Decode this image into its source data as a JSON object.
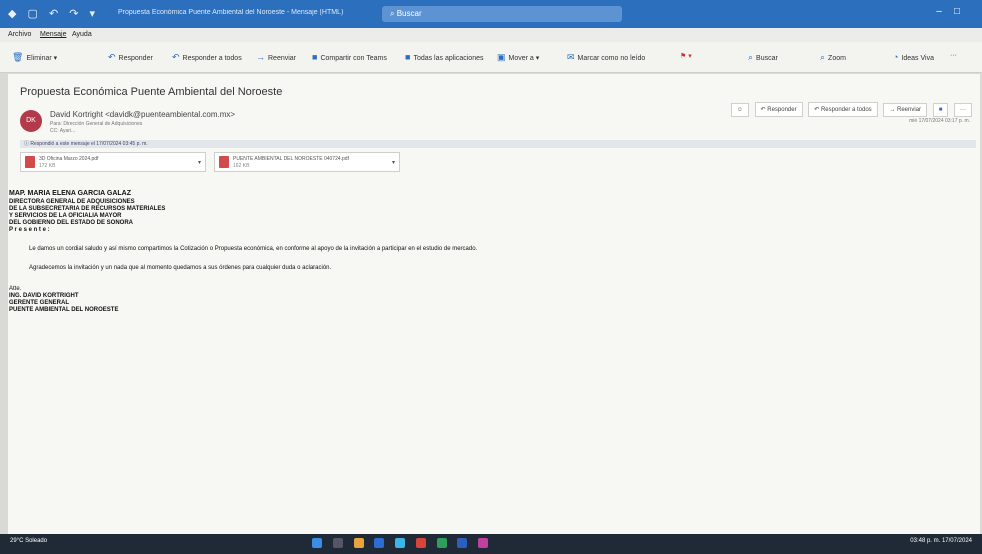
{
  "window": {
    "title": "Propuesta Económica Puente Ambiental del Noroeste - Mensaje (HTML)",
    "search_placeholder": "Buscar"
  },
  "menubar": {
    "items": [
      {
        "label": "Archivo"
      },
      {
        "label": "Mensaje"
      },
      {
        "label": "Ayuda"
      }
    ]
  },
  "ribbon": {
    "items": [
      {
        "label": "Eliminar",
        "icon": "trash-icon"
      },
      {
        "label": "Responder",
        "icon": "reply-icon"
      },
      {
        "label": "Responder a todos",
        "icon": "reply-all-icon"
      },
      {
        "label": "Reenviar",
        "icon": "forward-icon"
      },
      {
        "label": "Compartir con Teams",
        "icon": "teams-icon"
      },
      {
        "label": "Todas las aplicaciones",
        "icon": "apps-icon"
      },
      {
        "label": "Mover a",
        "icon": "move-icon"
      },
      {
        "label": "Marcar como no leído",
        "icon": "mail-icon"
      },
      {
        "label": "Buscar",
        "icon": "search-icon"
      },
      {
        "label": "Zoom",
        "icon": "zoom-icon"
      },
      {
        "label": "Ideas Viva",
        "icon": "viva-icon"
      }
    ]
  },
  "message": {
    "subject": "Propuesta Económica Puente Ambiental del Noroeste",
    "avatar_initials": "DK",
    "from": "David Kortright <davidk@puenteambiental.com.mx>",
    "to": "Para: Dirección General de Adquisiciones",
    "cc": "CC: Ayari...",
    "info_bar": "Respondió a este mensaje el 17/07/2024 03:45 p. m.",
    "date": "mié 17/07/2024 03:17 p. m.",
    "actions": {
      "reply": "Responder",
      "reply_all": "Responder a todos",
      "forward": "Reenviar"
    }
  },
  "attachments": [
    {
      "name": "3D Oficina Marzo 2024.pdf",
      "size": "172 KB"
    },
    {
      "name": "PUENTE AMBIENTAL DEL NOROESTE 040724.pdf",
      "size": "162 KB"
    }
  ],
  "body": {
    "addressee": [
      "MAP. MARIA ELENA GARCIA GALAZ",
      "DIRECTORA GENERAL DE ADQUISICIONES",
      "DE LA SUBSECRETARIA DE RECURSOS MATERIALES",
      "Y SERVICIOS DE LA OFICIALIA MAYOR",
      "DEL GOBIERNO DEL ESTADO DE SONORA",
      "P r e s e n t e :"
    ],
    "paragraphs": [
      "Le damos un cordial saludo y así mismo compartimos la Cotización o Propuesta económica, en conforme al apoyo de la invitación a participar en el estudio de mercado.",
      "Agradecemos la invitación y un nada que al momento quedamos a sus órdenes para cualquier duda o aclaración."
    ],
    "signature": [
      "Atte.",
      "ING. DAVID KORTRIGHT",
      "GERENTE GENERAL",
      "PUENTE AMBIENTAL DEL NOROESTE"
    ]
  },
  "taskbar": {
    "weather": "29°C Soleado",
    "time": "03:48 p. m.",
    "date": "17/07/2024"
  }
}
